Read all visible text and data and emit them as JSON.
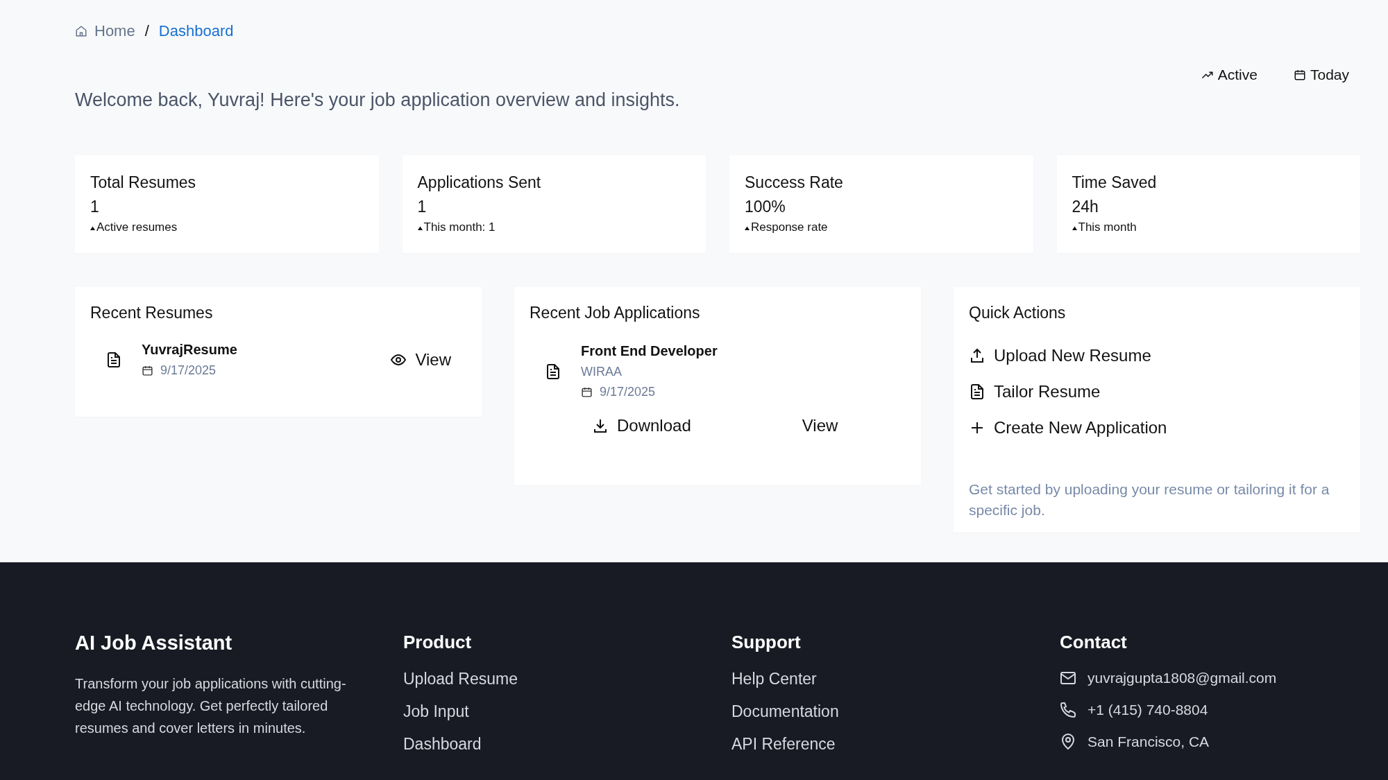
{
  "breadcrumb": [
    {
      "label": "Home",
      "kind": "home",
      "selected": false
    },
    {
      "label": "Dashboard",
      "kind": "page",
      "selected": true
    }
  ],
  "separator": "/",
  "header_badges": [
    {
      "label": "Active",
      "kind": "trend"
    },
    {
      "label": "Today",
      "kind": "calendar"
    }
  ],
  "welcome": "Welcome back, Yuvraj! Here's your job application overview and insights.",
  "stats": [
    {
      "title": "Total Resumes",
      "value": "1",
      "note": "Active resumes"
    },
    {
      "title": "Applications Sent",
      "value": "1",
      "note": "This month: 1"
    },
    {
      "title": "Success Rate",
      "value": "100%",
      "note": "Response rate"
    },
    {
      "title": "Time Saved",
      "value": "24h",
      "note": "This month"
    }
  ],
  "recent_resumes": {
    "title": "Recent Resumes",
    "items": [
      {
        "name": "YuvrajResume",
        "date": "9/17/2025",
        "action": "View"
      }
    ]
  },
  "recent_applications": {
    "title": "Recent Job Applications",
    "items": [
      {
        "role": "Front End Developer",
        "company": "WIRAA",
        "date": "9/17/2025",
        "actions": [
          {
            "label": "Download",
            "kind": "download"
          },
          {
            "label": "View",
            "kind": "plain"
          }
        ]
      }
    ]
  },
  "quick_actions": {
    "title": "Quick Actions",
    "items": [
      {
        "label": "Upload New Resume",
        "kind": "upload"
      },
      {
        "label": "Tailor Resume",
        "kind": "document"
      },
      {
        "label": "Create New Application",
        "kind": "plus"
      }
    ],
    "hint": "Get started by uploading your resume or tailoring it for a specific job."
  },
  "footer": {
    "brand": "AI Job Assistant",
    "description": "Transform your job applications with cutting-edge AI technology. Get perfectly tailored resumes and cover letters in minutes.",
    "columns": [
      {
        "title": "Product",
        "links": [
          "Upload Resume",
          "Job Input",
          "Dashboard"
        ]
      },
      {
        "title": "Support",
        "links": [
          "Help Center",
          "Documentation",
          "API Reference"
        ]
      }
    ],
    "contact": {
      "title": "Contact",
      "items": [
        {
          "text": "yuvrajgupta1808@gmail.com",
          "kind": "mail"
        },
        {
          "text": "+1 (415) 740-8804",
          "kind": "phone"
        },
        {
          "text": "San Francisco, CA",
          "kind": "location"
        }
      ]
    }
  }
}
